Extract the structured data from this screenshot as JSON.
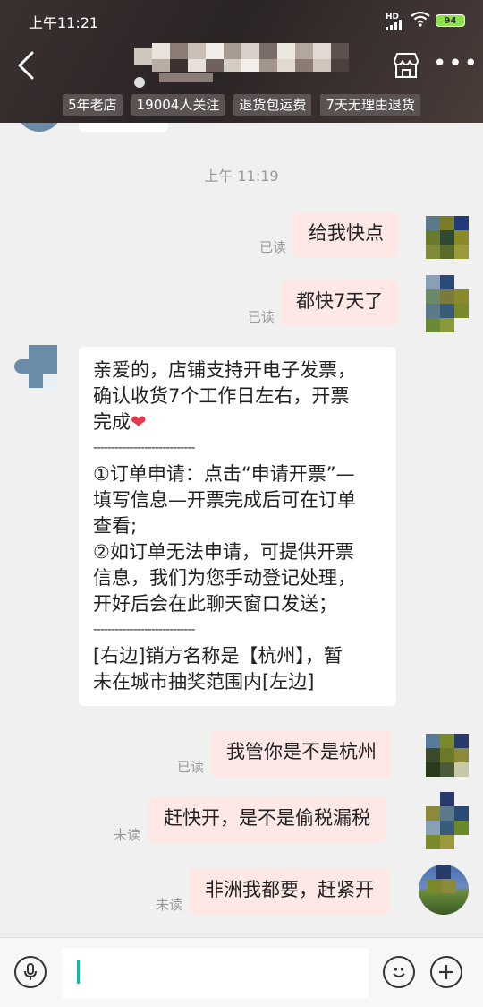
{
  "status_bar": {
    "time": "上午11:21",
    "hd_label": "HD",
    "battery": "94"
  },
  "header": {
    "tags": [
      "5年老店",
      "19004人关注",
      "退货包运费",
      "7天无理由退货"
    ]
  },
  "chat": {
    "timestamp": "上午 11:19",
    "messages": [
      {
        "text": "给我快点",
        "status": "已读"
      },
      {
        "text": "都快7天了",
        "status": "已读"
      },
      {
        "lines": [
          "亲爱的，店铺支持开电子发票，",
          "确认收货7个工作日左右，开票",
          "完成",
          "----------------------------",
          "①订单申请：点击“申请开票”—",
          "填写信息—开票完成后可在订单",
          "查看;",
          "②如订单无法申请，可提供开票",
          "信息，我们为您手动登记处理，",
          "开好后会在此聊天窗口发送；",
          "----------------------------",
          "[右边]销方名称是【杭州】，暂",
          "未在城市抽奖范围内[左边]"
        ]
      },
      {
        "text": "我管你是不是杭州",
        "status": "已读"
      },
      {
        "text": "赶快开，是不是偷税漏税",
        "status": "未读"
      },
      {
        "text": "非洲我都要，赶紧开",
        "status": "未读"
      }
    ]
  },
  "icons": {
    "back": "back-arrow-icon",
    "store": "store-icon",
    "more": "more-icon",
    "voice": "microphone-icon",
    "emoji": "emoji-icon",
    "plus": "plus-icon",
    "heart": "heart-icon"
  },
  "colors": {
    "outgoing_bubble": "#fde8e6",
    "incoming_bubble": "#ffffff",
    "caret": "#19b8a6",
    "heart": "#e8364a"
  }
}
